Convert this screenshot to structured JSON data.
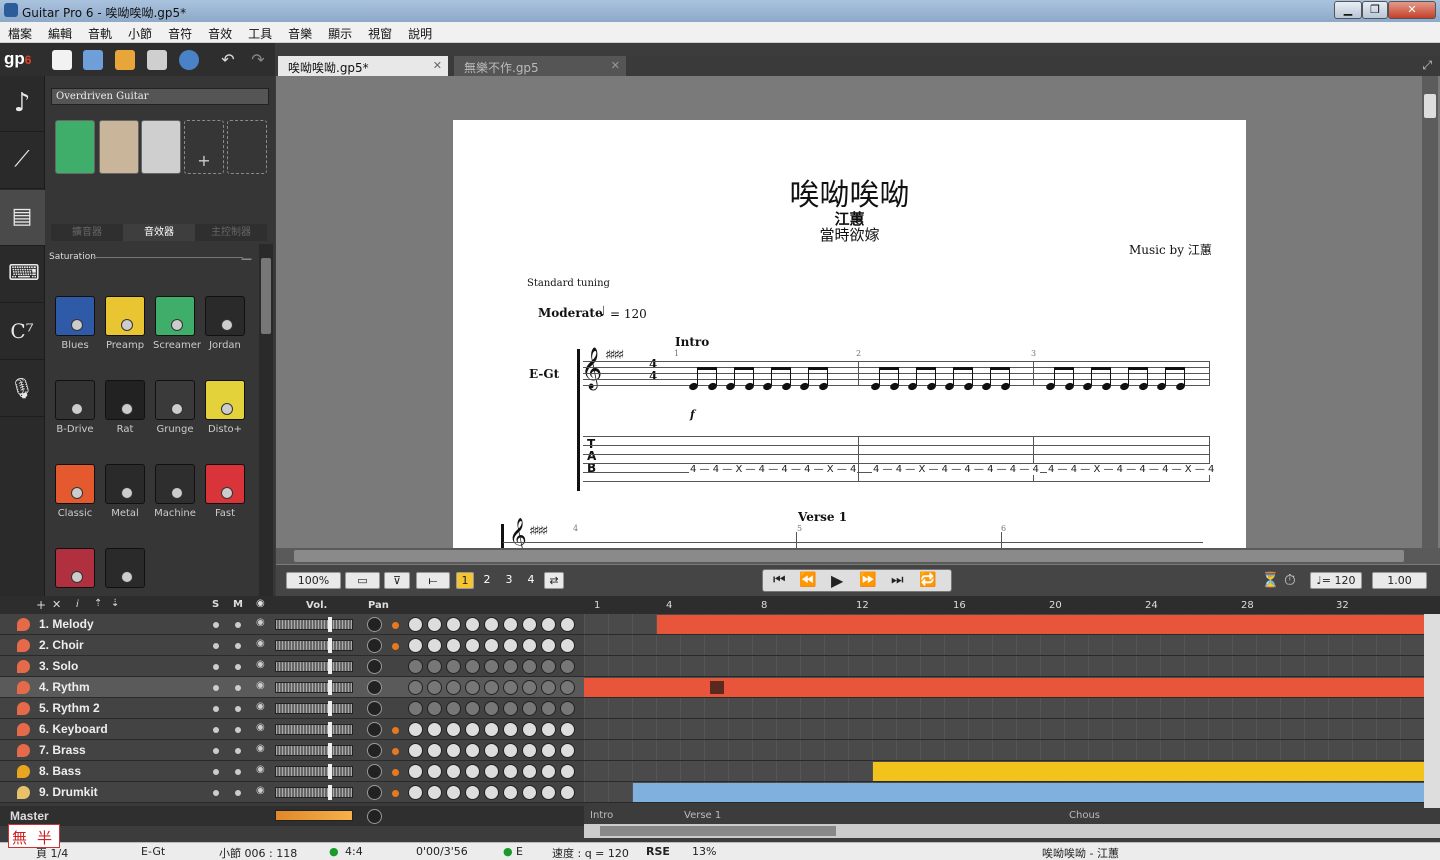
{
  "window": {
    "title": "Guitar Pro 6 - 唉呦唉呦.gp5*",
    "btn_min": "▁",
    "btn_max": "❐",
    "btn_close": "✕"
  },
  "menu": [
    "檔案",
    "編輯",
    "音軌",
    "小節",
    "音符",
    "音效",
    "工具",
    "音樂",
    "顯示",
    "視窗",
    "說明"
  ],
  "toolbar": {
    "logo": "gp",
    "logo_num": "6"
  },
  "doc_tabs": [
    {
      "label": "唉呦唉呦.gp5*",
      "active": true
    },
    {
      "label": "無樂不作.gp5",
      "active": false
    }
  ],
  "fx": {
    "preset": "Overdriven Guitar",
    "subtabs": [
      "擴音器",
      "音效器",
      "主控制器"
    ],
    "category": "Saturation",
    "pedals": [
      {
        "name": "Blues",
        "color": "#2f5aa8"
      },
      {
        "name": "Preamp",
        "color": "#e9c531"
      },
      {
        "name": "Screamer",
        "color": "#3fae6a"
      },
      {
        "name": "Jordan",
        "color": "#2a2a2a"
      },
      {
        "name": "B-Drive",
        "color": "#333333"
      },
      {
        "name": "Rat",
        "color": "#222222"
      },
      {
        "name": "Grunge",
        "color": "#3a3a3a"
      },
      {
        "name": "Disto+",
        "color": "#e3d23a"
      },
      {
        "name": "Classic",
        "color": "#e45a2e"
      },
      {
        "name": "Metal",
        "color": "#2a2a2a"
      },
      {
        "name": "Machine",
        "color": "#2e2e2e"
      },
      {
        "name": "Fast",
        "color": "#d8343a"
      }
    ]
  },
  "score": {
    "title": "唉呦唉呦",
    "artist": "江蕙",
    "album": "當時欲嫁",
    "music_by": "Music by 江蕙",
    "tuning": "Standard tuning",
    "tempo_label": "Moderate",
    "tempo_value": "= 120",
    "section_intro": "Intro",
    "section_verse": "Verse 1",
    "track_label": "E-Gt",
    "dynamic": "f",
    "tab_letters": [
      "T",
      "A",
      "B"
    ],
    "bar_numbers": [
      "1",
      "2",
      "3",
      "4",
      "5",
      "6"
    ],
    "tab_measures": [
      "4 — 4 — X — 4 — 4 — 4 — X — 4",
      "4 — 4 — X — 4 — 4 — 4 — 4 — 4",
      "4 — 4 — X — 4 — 4 — 4 — X — 4"
    ]
  },
  "transport": {
    "zoom": "100%",
    "voices": [
      "1",
      "2",
      "3",
      "4"
    ],
    "tempo": "= 120",
    "speed": "1.00"
  },
  "tracks_header": {
    "solo": "S",
    "mute": "M",
    "vol": "Vol.",
    "pan": "Pan"
  },
  "tracks": [
    {
      "name": "1. Melody",
      "icon": "#e56a4a"
    },
    {
      "name": "2. Choir",
      "icon": "#e56a4a"
    },
    {
      "name": "3. Solo",
      "icon": "#e56a4a"
    },
    {
      "name": "4. Rythm",
      "icon": "#e56a4a"
    },
    {
      "name": "5. Rythm 2",
      "icon": "#e56a4a"
    },
    {
      "name": "6. Keyboard",
      "icon": "#e56a4a"
    },
    {
      "name": "7. Brass",
      "icon": "#e56a4a"
    },
    {
      "name": "8. Bass",
      "icon": "#e8a520"
    },
    {
      "name": "9. Drumkit",
      "icon": "#e8c26a"
    }
  ],
  "master_label": "Master",
  "timeline": {
    "bar_numbers": [
      "1",
      "4",
      "8",
      "12",
      "16",
      "20",
      "24",
      "28",
      "32"
    ],
    "markers": [
      "Intro",
      "Verse 1",
      "Chous"
    ]
  },
  "status": {
    "page": "頁 1/4",
    "track": "E-Gt",
    "bar": "小節 006 : 118",
    "time_sig": "4:4",
    "time": "0'00/3'56",
    "key": "E",
    "tempo": "速度 : q = 120",
    "rse": "RSE",
    "cpu": "13%",
    "song": "唉呦唉呦 - 江蕙"
  },
  "ime": [
    "無",
    "半"
  ]
}
